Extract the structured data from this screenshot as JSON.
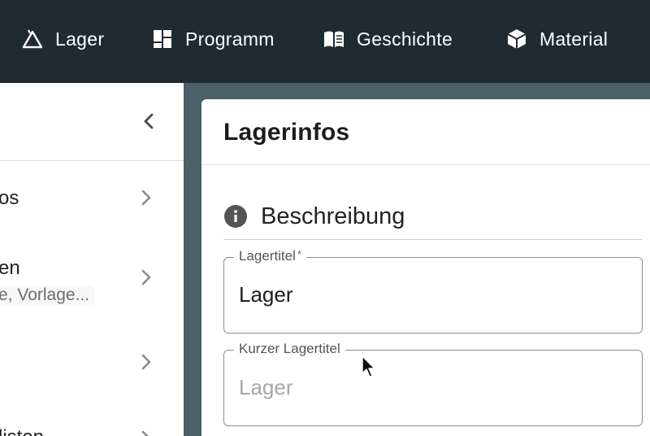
{
  "nav": {
    "items": [
      {
        "label": "Lager",
        "icon": "tent-icon"
      },
      {
        "label": "Programm",
        "icon": "dashboard-icon"
      },
      {
        "label": "Geschichte",
        "icon": "book-icon"
      },
      {
        "label": "Material",
        "icon": "cube-icon"
      }
    ]
  },
  "sidebar": {
    "items": [
      {
        "label": "os",
        "sub": ""
      },
      {
        "label": "en",
        "sub": "e, Vorlage..."
      },
      {
        "label": "",
        "sub": ""
      },
      {
        "label": "listen",
        "sub": ""
      }
    ]
  },
  "card": {
    "title": "Lagerinfos",
    "section_title": "Beschreibung",
    "fields": [
      {
        "label": "Lagertitel",
        "required_mark": "*",
        "value": "Lager"
      },
      {
        "label": "Kurzer Lagertitel",
        "placeholder": "Lager"
      }
    ]
  },
  "colors": {
    "topbar": "#1f2b31",
    "background": "#4a5f68",
    "card": "#ffffff"
  }
}
